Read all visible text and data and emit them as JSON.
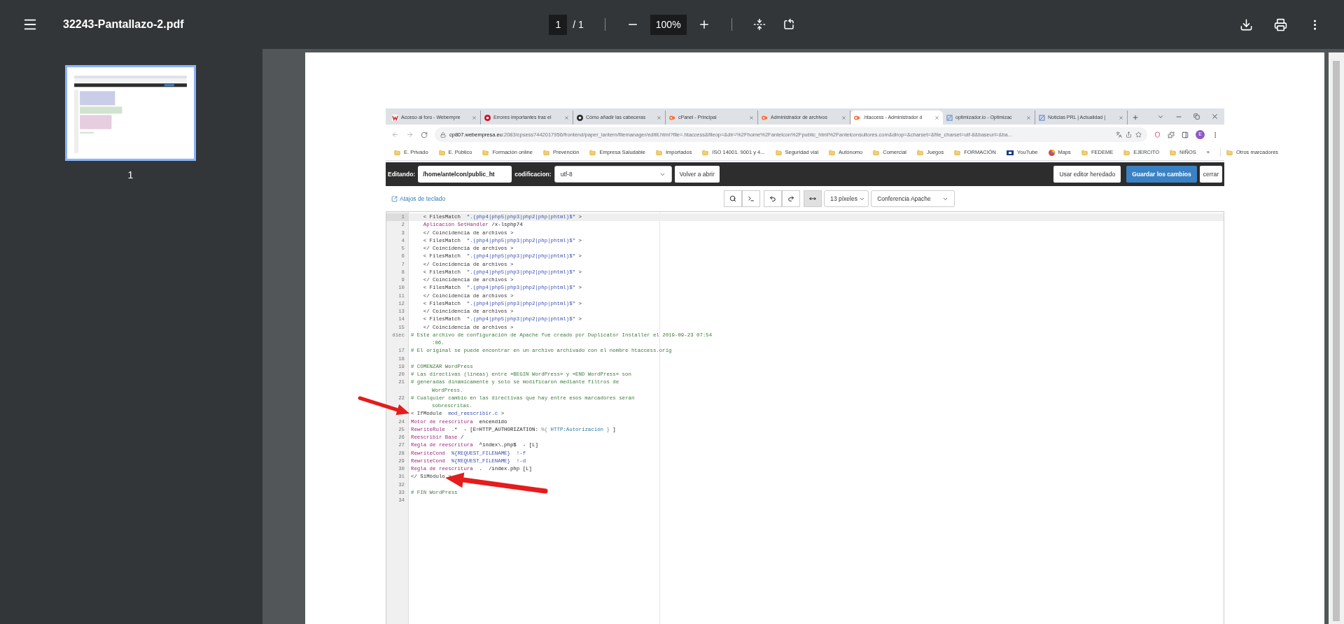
{
  "viewer": {
    "title": "32243-Pantallazo-2.pdf",
    "page": "1",
    "page_total": "/ 1",
    "zoom": "100%"
  },
  "sidebar": {
    "thumbnails": [
      {
        "label": "1",
        "selected": true
      }
    ]
  },
  "browser": {
    "tabs": [
      {
        "title": "Acceso al foro - Webempre",
        "kind": "w",
        "selected": false
      },
      {
        "title": "Errores importantes tras el",
        "kind": "error",
        "selected": false
      },
      {
        "title": "Cómo añadir las cabeceras",
        "kind": "dark",
        "selected": false
      },
      {
        "title": "cPanel - Principal",
        "kind": "cpanel",
        "selected": false
      },
      {
        "title": "Administrador de archivos",
        "kind": "cpanel",
        "selected": false
      },
      {
        "title": ".htaccess - Administrador d",
        "kind": "cpanel",
        "selected": true
      },
      {
        "title": "optimizador.io - Optimizac",
        "kind": "doc",
        "selected": false
      },
      {
        "title": "Noticias PRL | Actualidad |",
        "kind": "doc",
        "selected": false
      }
    ],
    "address": {
      "host": "cp807.webempresa.eu",
      "path": ":2083/cpsess7442017956/frontend/paper_lantern/filemanager/editit.html?file=.htaccess&fileop=&dir=%2Fhome%2Fantelcon%2Fpublic_html%2Fantelconsultores.com&dirop=&charset=&file_charset=utf-8&baseurl=&ba..."
    },
    "profile": "E",
    "bookmarks": [
      {
        "label": "E. Privado",
        "kind": "folder"
      },
      {
        "label": "E. Público",
        "kind": "folder"
      },
      {
        "label": "Formación online",
        "kind": "folder"
      },
      {
        "label": "Prevención",
        "kind": "folder"
      },
      {
        "label": "Empresa Saludable",
        "kind": "folder"
      },
      {
        "label": "Importados",
        "kind": "folder"
      },
      {
        "label": "ISO 14001. 9001 y 4...",
        "kind": "folder"
      },
      {
        "label": "Seguridad vial",
        "kind": "folder"
      },
      {
        "label": "Autónomo",
        "kind": "folder"
      },
      {
        "label": "Comercial",
        "kind": "folder"
      },
      {
        "label": "Juegos",
        "kind": "folder"
      },
      {
        "label": "FORMACIÓN",
        "kind": "folder"
      },
      {
        "label": "YouTube",
        "kind": "video"
      },
      {
        "label": "Maps",
        "kind": "maps"
      },
      {
        "label": "FEDEME",
        "kind": "folder"
      },
      {
        "label": "EJERCITO",
        "kind": "folder"
      },
      {
        "label": "NIÑOS",
        "kind": "folder"
      }
    ],
    "bookmarks_more": "»",
    "other_bookmarks": "Otros marcadores"
  },
  "editor": {
    "editing_label": "Editando:",
    "path": "/home/antelcon/public_ht",
    "encoding_label": "codificacion:",
    "encoding": "utf-8",
    "reopen": "Volver a abrir",
    "legacy": "Usar editor heredado",
    "save": "Guardar los cambios",
    "close": "cerrar",
    "shortcuts": "Atajos de teclado",
    "wrap_on": true,
    "font_size": "13 píxeles",
    "theme": "Conferencia Apache",
    "lines": [
      {
        "number": "1",
        "active": true,
        "segments": [
          {
            "kind": "tag",
            "text": "    < FilesMatch  "
          },
          {
            "kind": "string",
            "text": "\".(php4|php5|php3|php2|php|phtml)$\""
          },
          {
            "kind": "tag",
            "text": " >"
          }
        ]
      },
      {
        "number": "2",
        "active": false,
        "segments": [
          {
            "kind": "keyword",
            "text": "    Aplicación SetHandler"
          },
          {
            "kind": "plain",
            "text": " /x-lsphp74"
          }
        ]
      },
      {
        "number": "3",
        "active": false,
        "segments": [
          {
            "kind": "tag",
            "text": "    </ Coincidencia de archivos >"
          }
        ]
      },
      {
        "number": "4",
        "active": false,
        "segments": [
          {
            "kind": "tag",
            "text": "    < FilesMatch  "
          },
          {
            "kind": "string",
            "text": "\".(php4|php5|php3|php2|php|phtml)$\""
          },
          {
            "kind": "tag",
            "text": " >"
          }
        ]
      },
      {
        "number": "5",
        "active": false,
        "segments": [
          {
            "kind": "tag",
            "text": "    </ Coincidencia de archivos >"
          }
        ]
      },
      {
        "number": "6",
        "active": false,
        "segments": [
          {
            "kind": "tag",
            "text": "    < FilesMatch  "
          },
          {
            "kind": "string",
            "text": "\".(php4|php5|php3|php2|php|phtml)$\""
          },
          {
            "kind": "tag",
            "text": " >"
          }
        ]
      },
      {
        "number": "7",
        "active": false,
        "segments": [
          {
            "kind": "tag",
            "text": "    </ Coincidencia de archivos >"
          }
        ]
      },
      {
        "number": "8",
        "active": false,
        "segments": [
          {
            "kind": "tag",
            "text": "    < FilesMatch  "
          },
          {
            "kind": "string",
            "text": "\".(php4|php5|php3|php2|php|phtml)$\""
          },
          {
            "kind": "tag",
            "text": " >"
          }
        ]
      },
      {
        "number": "9",
        "active": false,
        "segments": [
          {
            "kind": "tag",
            "text": "    </ Coincidencia de archivos >"
          }
        ]
      },
      {
        "number": "10",
        "active": false,
        "segments": [
          {
            "kind": "tag",
            "text": "    < FilesMatch  "
          },
          {
            "kind": "string",
            "text": "\".(php4|php5|php3|php2|php|phtml)$\""
          },
          {
            "kind": "tag",
            "text": " >"
          }
        ]
      },
      {
        "number": "11",
        "active": false,
        "segments": [
          {
            "kind": "tag",
            "text": "    </ Coincidencia de archivos >"
          }
        ]
      },
      {
        "number": "12",
        "active": false,
        "segments": [
          {
            "kind": "tag",
            "text": "    < FilesMatch  "
          },
          {
            "kind": "string",
            "text": "\".(php4|php5|php3|php2|php|phtml)$\""
          },
          {
            "kind": "tag",
            "text": " >"
          }
        ]
      },
      {
        "number": "13",
        "active": false,
        "segments": [
          {
            "kind": "tag",
            "text": "    </ Coincidencia de archivos >"
          }
        ]
      },
      {
        "number": "14",
        "active": false,
        "segments": [
          {
            "kind": "tag",
            "text": "    < FilesMatch  "
          },
          {
            "kind": "string",
            "text": "\".(php4|php5|php3|php2|php|phtml)$\""
          },
          {
            "kind": "tag",
            "text": " >"
          }
        ]
      },
      {
        "number": "15",
        "active": false,
        "segments": [
          {
            "kind": "tag",
            "text": "    </ Coincidencia de archivos >"
          }
        ]
      },
      {
        "number": "diec",
        "active": false,
        "segments": [
          {
            "kind": "comment",
            "text": "# Este archivo de configuración de Apache fue creado por Duplicator Installer el 2019-09-23 07:54"
          }
        ],
        "continuation": ":06."
      },
      {
        "number": "17",
        "active": false,
        "segments": [
          {
            "kind": "comment",
            "text": "# El original se puede encontrar en un archivo archivado con el nombre htaccess.orig"
          }
        ]
      },
      {
        "number": "18",
        "active": false
      },
      {
        "number": "19",
        "active": false,
        "segments": [
          {
            "kind": "comment",
            "text": "# COMENZAR WordPress"
          }
        ]
      },
      {
        "number": "20",
        "active": false,
        "segments": [
          {
            "kind": "comment",
            "text": "# Las directivas (líneas) entre «BEGIN WordPress» y «END WordPress» son"
          }
        ]
      },
      {
        "number": "21",
        "active": false,
        "segments": [
          {
            "kind": "comment",
            "text": "# generadas dinámicamente y solo se modificaron mediante filtros de"
          }
        ],
        "continuation": "WordPress."
      },
      {
        "number": "22",
        "active": false,
        "segments": [
          {
            "kind": "comment",
            "text": "# Cualquier cambio en las directivas que hay entre esos marcadores seran"
          }
        ],
        "continuation": "sobrescritas."
      },
      {
        "active": false,
        "segments": [
          {
            "kind": "tag",
            "text": "< IfModule  "
          },
          {
            "kind": "string",
            "text": "mod_reescribir.c"
          },
          {
            "kind": "tag",
            "text": " >"
          }
        ]
      },
      {
        "number": "24",
        "active": false,
        "segments": [
          {
            "kind": "keyword",
            "text": "Motor de reescritura"
          },
          {
            "kind": "plain",
            "text": "  encendido"
          }
        ]
      },
      {
        "number": "25",
        "active": false,
        "segments": [
          {
            "kind": "keyword",
            "text": "RewriteRule"
          },
          {
            "kind": "plain",
            "text": "  .*  - [E=HTTP_AUTHORIZATION: "
          },
          {
            "kind": "op",
            "text": "%{"
          },
          {
            "kind": "attr",
            "text": " HTTP:Autorización "
          },
          {
            "kind": "op",
            "text": "}"
          },
          {
            "kind": "plain",
            "text": " ]"
          }
        ]
      },
      {
        "number": "26",
        "active": false,
        "segments": [
          {
            "kind": "keyword",
            "text": "Reescribir Base"
          },
          {
            "kind": "plain",
            "text": " /"
          }
        ]
      },
      {
        "number": "27",
        "active": false,
        "segments": [
          {
            "kind": "keyword",
            "text": "Regla de reescritura"
          },
          {
            "kind": "plain",
            "text": "  ^index\\.php$  - [L]"
          }
        ]
      },
      {
        "number": "28",
        "active": false,
        "segments": [
          {
            "kind": "keyword",
            "text": "RewriteCond"
          },
          {
            "kind": "string",
            "text": "  %{REQUEST_FILENAME}  !-f"
          }
        ]
      },
      {
        "number": "29",
        "active": false,
        "segments": [
          {
            "kind": "keyword",
            "text": "RewriteCond"
          },
          {
            "kind": "string",
            "text": "  %{REQUEST_FILENAME}  !-d"
          }
        ]
      },
      {
        "number": "30",
        "active": false,
        "segments": [
          {
            "kind": "keyword",
            "text": "Regla de reescritura"
          },
          {
            "kind": "plain",
            "text": "  .  /index.php [L]"
          }
        ]
      },
      {
        "number": "31",
        "active": false,
        "segments": [
          {
            "kind": "tag",
            "text": "</ SiMódulo >"
          }
        ]
      },
      {
        "number": "32",
        "active": false
      },
      {
        "number": "33",
        "active": false,
        "segments": [
          {
            "kind": "comment",
            "text": "# FIN WordPress"
          }
        ]
      },
      {
        "number": "34",
        "active": false
      }
    ]
  }
}
